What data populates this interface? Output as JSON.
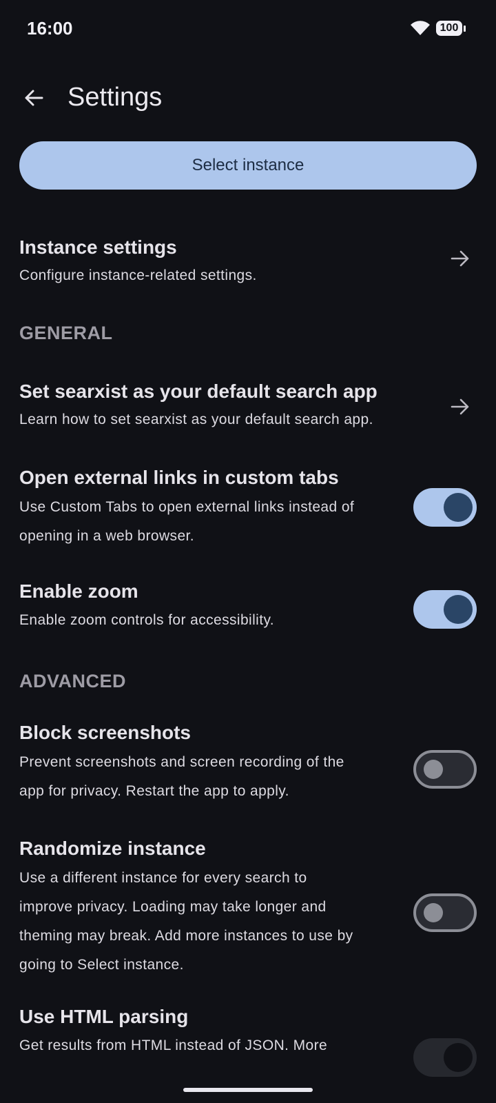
{
  "status_bar": {
    "time": "16:00",
    "battery": "100"
  },
  "header": {
    "title": "Settings"
  },
  "select_button": "Select instance",
  "instance_settings": {
    "title": "Instance settings",
    "subtitle": "Configure instance-related settings."
  },
  "sections": {
    "general": "GENERAL",
    "advanced": "ADVANCED"
  },
  "general": {
    "default_app": {
      "title": "Set searxist as your default search app",
      "subtitle": "Learn how to set searxist as your default search app."
    },
    "custom_tabs": {
      "title": "Open external links in custom tabs",
      "subtitle": "Use Custom Tabs to open external links instead of opening in a web browser.",
      "enabled": true
    },
    "zoom": {
      "title": "Enable zoom",
      "subtitle": "Enable zoom controls for accessibility.",
      "enabled": true
    }
  },
  "advanced": {
    "block_screenshots": {
      "title": "Block screenshots",
      "subtitle": "Prevent screenshots and screen recording of the app for privacy. Restart the app to apply.",
      "enabled": false
    },
    "randomize_instance": {
      "title": "Randomize instance",
      "subtitle": "Use a different instance for every search to improve privacy. Loading may take longer and theming may break. Add more instances to use by going to Select instance.",
      "enabled": false
    },
    "html_parsing": {
      "title": "Use HTML parsing",
      "subtitle": "Get results from HTML instead of JSON. More"
    }
  },
  "colors": {
    "background": "#101116",
    "accent": "#adc6ec",
    "accent_dark": "#2a4566"
  },
  "icons": {
    "back": "arrow-left-icon",
    "chevron": "arrow-right-icon",
    "wifi": "wifi-icon",
    "battery": "battery-icon"
  }
}
